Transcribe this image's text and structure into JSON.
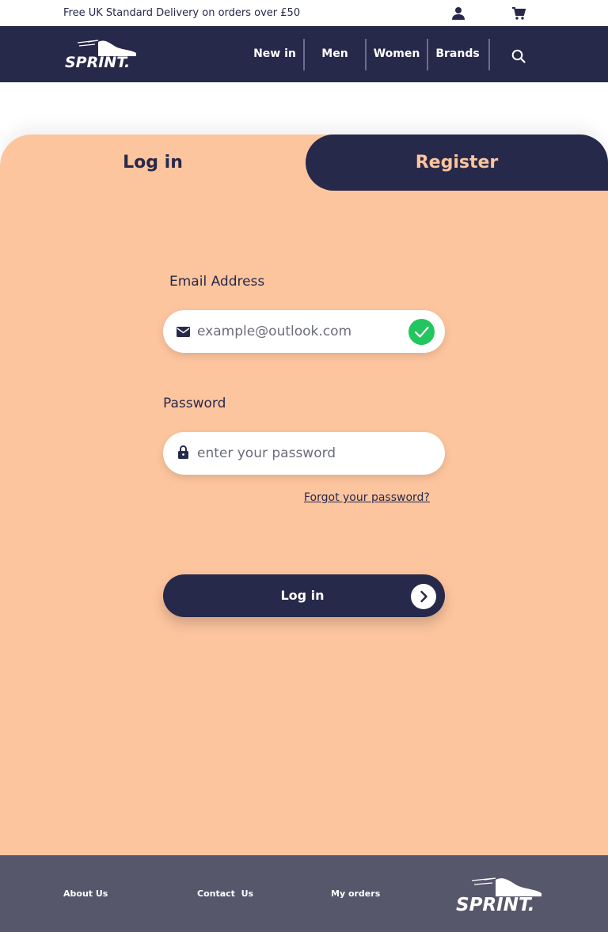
{
  "promo": {
    "text": "Free UK Standard Delivery on orders over £50"
  },
  "header": {
    "logo_text": "SPRINT.",
    "nav": [
      "New in",
      "Men",
      "Women",
      "Brands"
    ]
  },
  "icons": {
    "account": "person-icon",
    "cart": "cart-icon",
    "search": "search-icon",
    "email": "mail-icon",
    "password": "lock-icon",
    "valid": "check-icon",
    "submit": "chevron-right-icon"
  },
  "auth": {
    "tabs": {
      "login": "Log in",
      "register": "Register"
    },
    "email": {
      "label": "Email Address",
      "placeholder": "example@outlook.com",
      "value": ""
    },
    "password": {
      "label": "Password",
      "placeholder": "enter your password",
      "value": ""
    },
    "forgot": "Forgot your password?",
    "submit": "Log in"
  },
  "footer": {
    "links": [
      "About Us",
      "Contact  Us",
      "My orders"
    ],
    "logo_text": "SPRINT."
  },
  "colors": {
    "navy": "#27294a",
    "peach": "#fdc59e",
    "footer": "#56576b",
    "success": "#22c55e"
  }
}
